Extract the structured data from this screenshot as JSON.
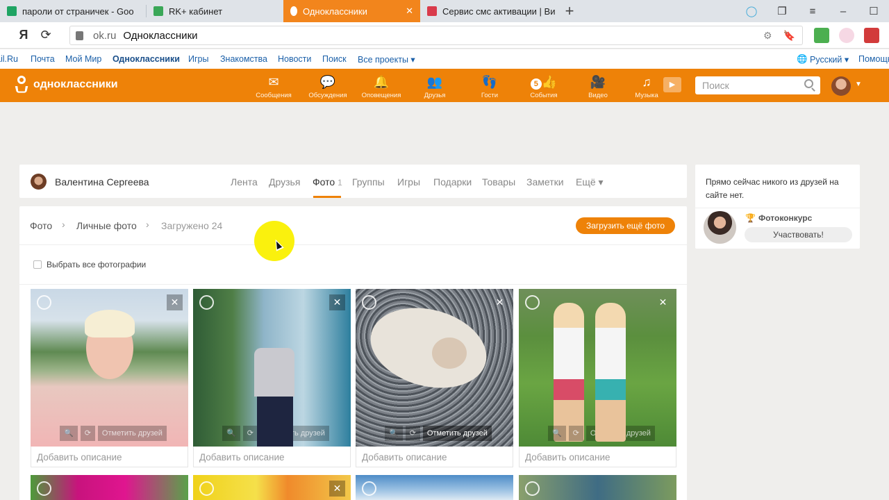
{
  "browser": {
    "tabs": [
      {
        "title": "пароли от страничек - Goo",
        "favicon_color": "#1fa463",
        "active": false
      },
      {
        "title": "RK+ кабинет",
        "favicon_color": "#3aa757",
        "active": false
      },
      {
        "title": "Одноклассники",
        "favicon_color": "#ffffff",
        "active": true
      },
      {
        "title": "Сервис смс активации | Ви",
        "favicon_color": "#d93b4b",
        "active": false
      }
    ],
    "url_host": "ok.ru",
    "url_title": "Одноклассники",
    "back_glyph": "Я"
  },
  "services": {
    "items": [
      {
        "label": "ail.Ru",
        "bold": false
      },
      {
        "label": "Почта",
        "bold": false
      },
      {
        "label": "Мой Мир",
        "bold": false
      },
      {
        "label": "Одноклассники",
        "bold": true
      },
      {
        "label": "Игры",
        "bold": false
      },
      {
        "label": "Знакомства",
        "bold": false
      },
      {
        "label": "Новости",
        "bold": false
      },
      {
        "label": "Поиск",
        "bold": false
      },
      {
        "label": "Все проекты ▾",
        "bold": false
      }
    ],
    "language": "Русский ▾",
    "help": "Помощь"
  },
  "ok": {
    "logo": "одноклассники",
    "nav": [
      {
        "label": "Сообщения",
        "icon": "envelope-icon"
      },
      {
        "label": "Обсуждения",
        "icon": "chat-icon"
      },
      {
        "label": "Оповещения",
        "icon": "bell-icon"
      },
      {
        "label": "Друзья",
        "icon": "friends-icon"
      },
      {
        "label": "Гости",
        "icon": "footprints-icon"
      },
      {
        "label": "События",
        "icon": "events-icon",
        "badge": "5"
      },
      {
        "label": "Видео",
        "icon": "video-camera-icon"
      },
      {
        "label": "Музыка",
        "icon": "music-note-icon"
      }
    ],
    "search_placeholder": "Поиск",
    "accent": "#ee8208"
  },
  "profile": {
    "name": "Валентина Сергеева",
    "tabs": [
      {
        "label": "Лента"
      },
      {
        "label": "Друзья"
      },
      {
        "label": "Фото",
        "count": "1",
        "active": true
      },
      {
        "label": "Группы"
      },
      {
        "label": "Игры"
      },
      {
        "label": "Подарки"
      },
      {
        "label": "Товары"
      },
      {
        "label": "Заметки"
      },
      {
        "label": "Ещё ▾"
      }
    ]
  },
  "photos": {
    "breadcrumb": [
      "Фото",
      "Личные фото",
      "Загружено 24"
    ],
    "upload_label": "Загрузить ещё фото",
    "select_all_label": "Выбрать все фотографии",
    "tag_friends_label": "Отметить друзей",
    "add_description_label": "Добавить описание",
    "close_glyph": "✕"
  },
  "sidebar": {
    "no_friends_text": "Прямо сейчас никого из друзей на сайте нет.",
    "contest_title": "Фотоконкурс",
    "join_label": "Участвовать!"
  }
}
